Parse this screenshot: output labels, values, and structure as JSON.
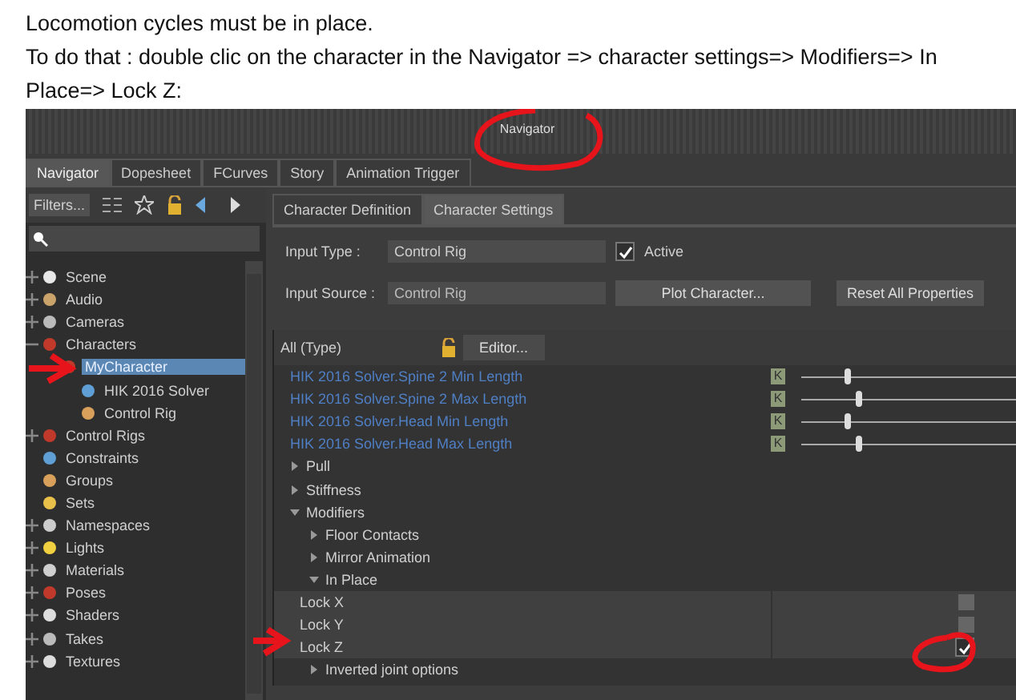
{
  "instructions": [
    "Locomotion cycles must be in place.",
    "To do that : double clic on the character in the Navigator => character settings=> Modifiers=> In Place=> Lock Z:"
  ],
  "window": {
    "title": "Navigator"
  },
  "tabs": [
    {
      "label": "Navigator",
      "selected": true
    },
    {
      "label": "Dopesheet",
      "selected": false
    },
    {
      "label": "FCurves",
      "selected": false
    },
    {
      "label": "Story",
      "selected": false
    },
    {
      "label": "Animation Trigger",
      "selected": false
    }
  ],
  "navigator": {
    "filter_button": "Filters...",
    "tree": [
      {
        "label": "Scene",
        "expanded": false,
        "selected": false
      },
      {
        "label": "Audio",
        "expanded": false,
        "selected": false
      },
      {
        "label": "Cameras",
        "expanded": false,
        "selected": false
      },
      {
        "label": "Characters",
        "expanded": true,
        "selected": false,
        "children": [
          {
            "label": "MyCharacter",
            "selected": true,
            "children": [
              {
                "label": "HIK 2016 Solver",
                "selected": false
              },
              {
                "label": "Control Rig",
                "selected": false
              }
            ]
          }
        ]
      },
      {
        "label": "Control Rigs",
        "expanded": false,
        "selected": false
      },
      {
        "label": "Constraints",
        "selected": false
      },
      {
        "label": "Groups",
        "selected": false
      },
      {
        "label": "Sets",
        "selected": false
      },
      {
        "label": "Namespaces",
        "expanded": false,
        "selected": false
      },
      {
        "label": "Lights",
        "expanded": false,
        "selected": false
      },
      {
        "label": "Materials",
        "expanded": false,
        "selected": false
      },
      {
        "label": "Poses",
        "expanded": false,
        "selected": false
      },
      {
        "label": "Shaders",
        "expanded": false,
        "selected": false
      },
      {
        "label": "Takes",
        "expanded": false,
        "selected": false
      },
      {
        "label": "Textures",
        "expanded": false,
        "selected": false
      }
    ]
  },
  "settings_tabs": [
    {
      "label": "Character Definition",
      "selected": false
    },
    {
      "label": "Character Settings",
      "selected": true
    }
  ],
  "input_type": {
    "label": "Input Type :",
    "value": "Control Rig"
  },
  "active": {
    "label": "Active",
    "checked": true
  },
  "input_source": {
    "label": "Input Source :",
    "value": "Control Rig"
  },
  "buttons": [
    "Plot Character...",
    "Reset All Properties"
  ],
  "filter": {
    "value": "All (Type)",
    "editor_button": "Editor..."
  },
  "properties": [
    {
      "kind": "slider",
      "label": "HIK 2016 Solver.Spine 2 Min Length",
      "key": "K",
      "level": 0.2
    },
    {
      "kind": "slider",
      "label": "HIK 2016 Solver.Spine 2 Max Length",
      "key": "K",
      "level": 0.25
    },
    {
      "kind": "slider",
      "label": "HIK 2016 Solver.Head Min Length",
      "key": "K",
      "level": 0.2
    },
    {
      "kind": "slider",
      "label": "HIK 2016 Solver.Head Max Length",
      "key": "K",
      "level": 0.25
    },
    {
      "kind": "group",
      "label": "Pull",
      "expanded": false
    },
    {
      "kind": "group",
      "label": "Stiffness",
      "expanded": false
    },
    {
      "kind": "group",
      "label": "Modifiers",
      "expanded": true,
      "children": [
        {
          "kind": "group",
          "label": "Floor Contacts",
          "expanded": false
        },
        {
          "kind": "group",
          "label": "Mirror Animation",
          "expanded": false
        },
        {
          "kind": "group",
          "label": "In Place",
          "expanded": true,
          "children": [
            {
              "kind": "checkbox",
              "label": "Lock X",
              "checked": false
            },
            {
              "kind": "checkbox",
              "label": "Lock Y",
              "checked": false
            },
            {
              "kind": "checkbox",
              "label": "Lock Z",
              "checked": true
            }
          ]
        },
        {
          "kind": "group",
          "label": "Inverted joint options",
          "expanded": false
        }
      ]
    }
  ]
}
